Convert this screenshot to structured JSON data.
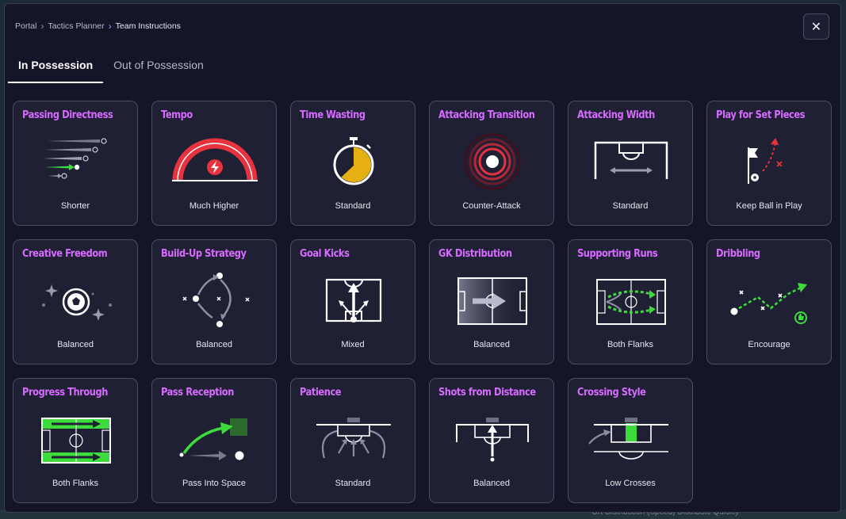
{
  "breadcrumb": {
    "items": [
      "Portal",
      "Tactics Planner",
      "Team Instructions"
    ]
  },
  "tabs": [
    {
      "label": "In Possession",
      "active": true
    },
    {
      "label": "Out of Possession",
      "active": false
    }
  ],
  "close_glyph": "✕",
  "background_text": "GK Distribution (Speed)   Distribute Quickly",
  "colors": {
    "accent_title": "#d86bff",
    "accent_green": "#3ddc3d",
    "accent_red": "#e8323e",
    "accent_gold": "#e6b012"
  },
  "cards": [
    {
      "title": "Passing Directness",
      "value": "Shorter",
      "icon": "passing-directness-icon"
    },
    {
      "title": "Tempo",
      "value": "Much Higher",
      "icon": "tempo-gauge-icon"
    },
    {
      "title": "Time Wasting",
      "value": "Standard",
      "icon": "stopwatch-icon"
    },
    {
      "title": "Attacking Transition",
      "value": "Counter-Attack",
      "icon": "radar-rings-icon"
    },
    {
      "title": "Attacking Width",
      "value": "Standard",
      "icon": "pitch-width-icon"
    },
    {
      "title": "Play for Set Pieces",
      "value": "Keep Ball in Play",
      "icon": "corner-flag-icon"
    },
    {
      "title": "Creative Freedom",
      "value": "Balanced",
      "icon": "ball-sparkle-icon"
    },
    {
      "title": "Build-Up Strategy",
      "value": "Balanced",
      "icon": "build-up-icon"
    },
    {
      "title": "Goal Kicks",
      "value": "Mixed",
      "icon": "goal-kick-icon"
    },
    {
      "title": "GK Distribution",
      "value": "Balanced",
      "icon": "gk-distribution-icon"
    },
    {
      "title": "Supporting Runs",
      "value": "Both Flanks",
      "icon": "supporting-runs-icon"
    },
    {
      "title": "Dribbling",
      "value": "Encourage",
      "icon": "dribbling-icon"
    },
    {
      "title": "Progress Through",
      "value": "Both Flanks",
      "icon": "progress-through-icon"
    },
    {
      "title": "Pass Reception",
      "value": "Pass Into Space",
      "icon": "pass-reception-icon"
    },
    {
      "title": "Patience",
      "value": "Standard",
      "icon": "patience-icon"
    },
    {
      "title": "Shots from Distance",
      "value": "Balanced",
      "icon": "shots-distance-icon"
    },
    {
      "title": "Crossing Style",
      "value": "Low Crosses",
      "icon": "crossing-style-icon"
    }
  ]
}
